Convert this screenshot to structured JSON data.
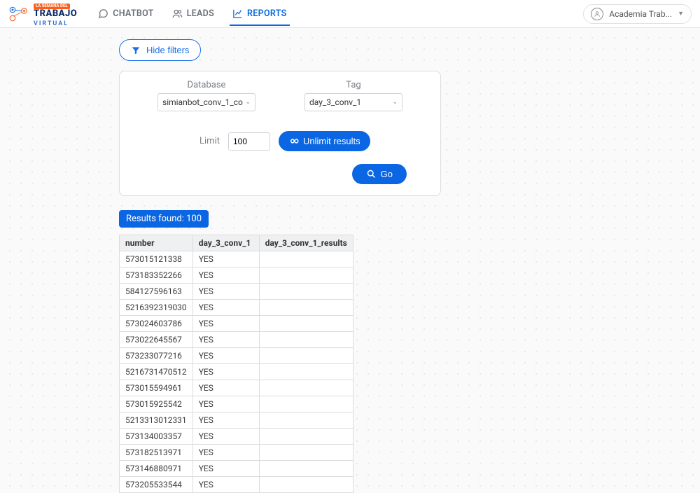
{
  "logo": {
    "badge": "LA SEMANA DEL",
    "main": "TRABAJO",
    "sub": "VIRTUAL"
  },
  "nav": {
    "chatbot": "CHATBOT",
    "leads": "LEADS",
    "reports": "REPORTS"
  },
  "user": {
    "name": "Academia Trab..."
  },
  "filters": {
    "hide_label": "Hide filters",
    "database_label": "Database",
    "database_value": "simianbot_conv_1_co",
    "tag_label": "Tag",
    "tag_value": "day_3_conv_1",
    "limit_label": "Limit",
    "limit_value": "100",
    "unlimit_label": "Unlimit results",
    "go_label": "Go"
  },
  "results": {
    "found_label": "Results found: 100",
    "columns": [
      "number",
      "day_3_conv_1",
      "day_3_conv_1_results"
    ],
    "rows": [
      {
        "number": "573015121338",
        "c1": "YES",
        "c2": ""
      },
      {
        "number": "573183352266",
        "c1": "YES",
        "c2": ""
      },
      {
        "number": "584127596163",
        "c1": "YES",
        "c2": ""
      },
      {
        "number": "5216392319030",
        "c1": "YES",
        "c2": ""
      },
      {
        "number": "573024603786",
        "c1": "YES",
        "c2": ""
      },
      {
        "number": "573022645567",
        "c1": "YES",
        "c2": ""
      },
      {
        "number": "573233077216",
        "c1": "YES",
        "c2": ""
      },
      {
        "number": "5216731470512",
        "c1": "YES",
        "c2": ""
      },
      {
        "number": "573015594961",
        "c1": "YES",
        "c2": ""
      },
      {
        "number": "573015925542",
        "c1": "YES",
        "c2": ""
      },
      {
        "number": "5213313012331",
        "c1": "YES",
        "c2": ""
      },
      {
        "number": "573134003357",
        "c1": "YES",
        "c2": ""
      },
      {
        "number": "573182513971",
        "c1": "YES",
        "c2": ""
      },
      {
        "number": "573146880971",
        "c1": "YES",
        "c2": ""
      },
      {
        "number": "573205533544",
        "c1": "YES",
        "c2": ""
      }
    ]
  }
}
